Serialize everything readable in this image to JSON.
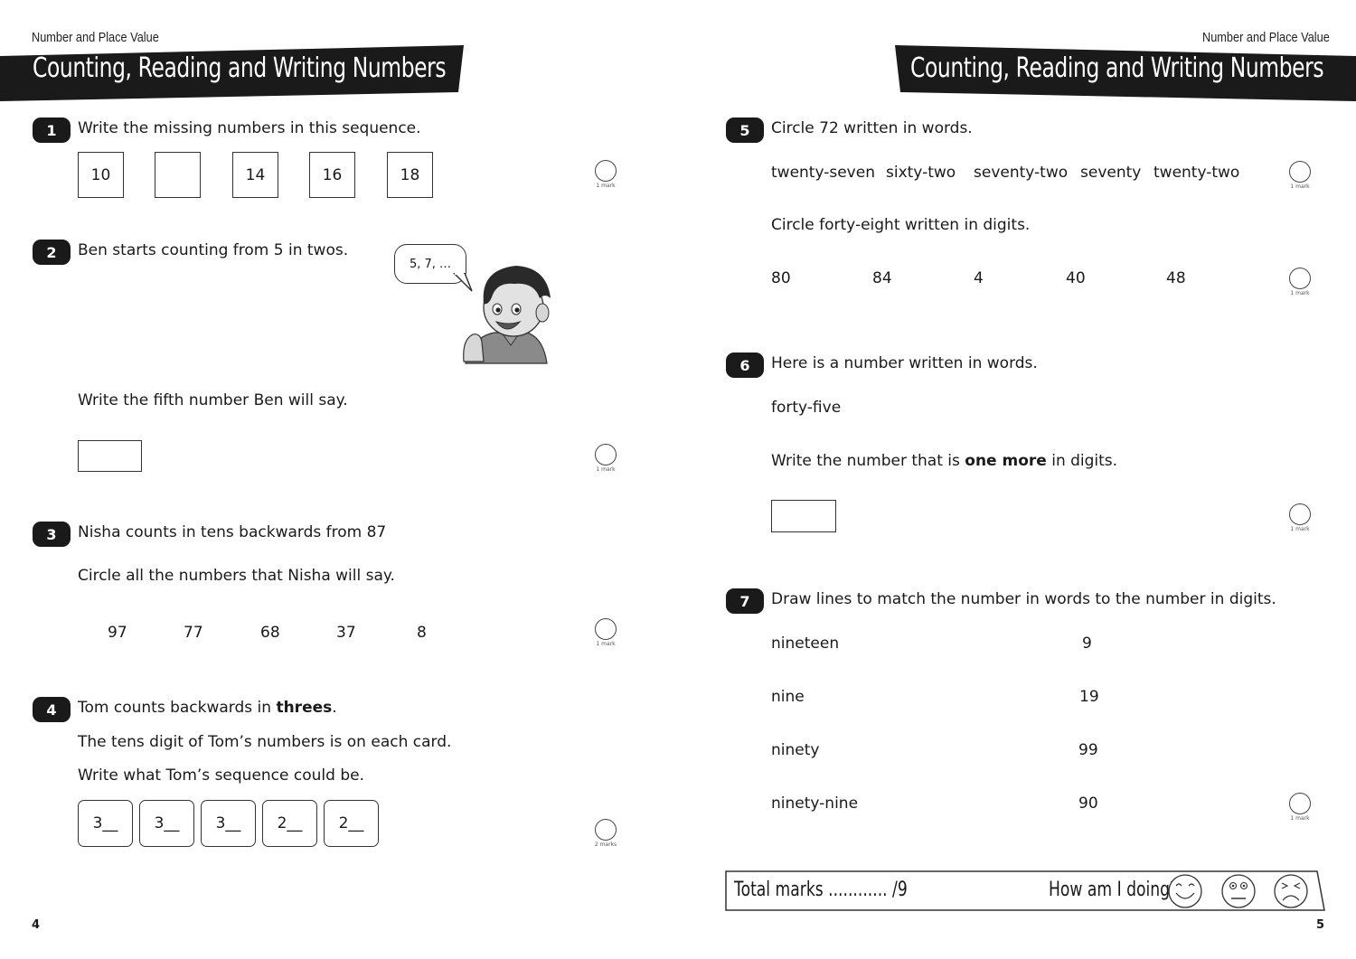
{
  "left_page": {
    "topic": "Number and Place Value",
    "title": "Counting, Reading and Writing Numbers",
    "page_number": "4",
    "questions": {
      "q1": {
        "number": "1",
        "text": "Write the missing numbers in this sequence.",
        "boxes": [
          "10",
          "",
          "14",
          "16",
          "18"
        ],
        "marks": "1 mark"
      },
      "q2": {
        "number": "2",
        "text": "Ben starts counting from 5 in twos.",
        "speech": "5, 7, …",
        "prompt": "Write the fifth number Ben will say.",
        "answer": "",
        "marks": "1 mark"
      },
      "q3": {
        "number": "3",
        "text": "Nisha counts in tens backwards from 87",
        "prompt": "Circle all the numbers that Nisha will say.",
        "options": [
          "97",
          "77",
          "68",
          "37",
          "8"
        ],
        "marks": "1 mark"
      },
      "q4": {
        "number": "4",
        "text_pre": "Tom counts backwards in ",
        "text_bold": "threes",
        "text_post": ".",
        "line2": "The tens digit of Tom’s numbers is on each card.",
        "line3": "Write what Tom’s sequence could be.",
        "cards": [
          "3__",
          "3__",
          "3__",
          "2__",
          "2__"
        ],
        "marks": "2 marks"
      }
    }
  },
  "right_page": {
    "topic": "Number and Place Value",
    "title": "Counting, Reading and Writing Numbers",
    "page_number": "5",
    "questions": {
      "q5": {
        "number": "5",
        "text": "Circle 72 written in words.",
        "word_options": [
          "twenty-seven",
          "sixty-two",
          "seventy-two",
          "seventy",
          "twenty-two"
        ],
        "marks_a": "1 mark",
        "prompt2": "Circle forty-eight written in digits.",
        "digit_options": [
          "80",
          "84",
          "4",
          "40",
          "48"
        ],
        "marks_b": "1 mark"
      },
      "q6": {
        "number": "6",
        "text": "Here is a number written in words.",
        "word": "forty-five",
        "prompt_pre": "Write the number that is ",
        "prompt_bold": "one more",
        "prompt_post": " in digits.",
        "answer": "",
        "marks": "1 mark"
      },
      "q7": {
        "number": "7",
        "text": "Draw lines to match the number in words to the number in digits.",
        "words": [
          "nineteen",
          "nine",
          "ninety",
          "ninety-nine"
        ],
        "digits": [
          "9",
          "19",
          "99",
          "90"
        ],
        "marks": "1 mark"
      }
    },
    "footer": {
      "total_label": "Total marks ............ /9",
      "how_label": "How am I doing?",
      "faces": [
        "happy-face",
        "neutral-face",
        "sad-face"
      ]
    }
  }
}
